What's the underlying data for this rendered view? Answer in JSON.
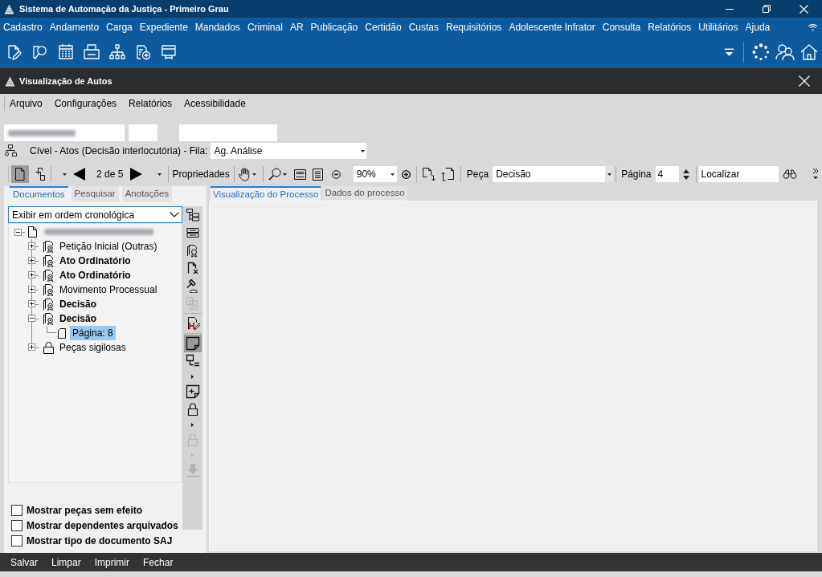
{
  "window": {
    "title": "Sistema de Automação da Justiça - Primeiro Grau"
  },
  "main_menu": [
    "Cadastro",
    "Andamento",
    "Carga",
    "Expediente",
    "Mandados",
    "Criminal",
    "AR",
    "Publicação",
    "Certidão",
    "Custas",
    "Requisitórios",
    "Adolescente Infrator",
    "Consulta",
    "Relatórios",
    "Utilitários",
    "Ajuda"
  ],
  "dialog": {
    "title": "Visualização de Autos"
  },
  "dialog_menu": [
    "Arquivo",
    "Configurações",
    "Relatórios",
    "Acessibilidade"
  ],
  "workflow": {
    "label": "Cível - Atos (Decisão interlocutória) - Fila:",
    "queue": "Ag. Análise"
  },
  "toolbar": {
    "view_modes": [
      {
        "selected": true
      },
      {
        "selected": false
      }
    ],
    "position": "2 de 5",
    "properties": "Propriedades",
    "zoom": "90%",
    "piece_label": "Peça",
    "piece": "Decisão",
    "page_label": "Página",
    "page": "4",
    "search": "Localizar"
  },
  "document_tabs": [
    {
      "label": "Documentos",
      "selected": true
    },
    {
      "label": "Pesquisar",
      "selected": false
    },
    {
      "label": "Anotações",
      "selected": false
    }
  ],
  "order_select": "Exibir em ordem cronológica",
  "tree": [
    {
      "kind": "process",
      "expanded": true,
      "selected": false,
      "children": [
        {
          "kind": "document",
          "label": "Petição Inicial (Outras)",
          "bold": false,
          "expanded": false,
          "selected": false
        },
        {
          "kind": "document",
          "label": "Ato Ordinatório",
          "bold": true,
          "expanded": false,
          "selected": false
        },
        {
          "kind": "document",
          "label": "Ato Ordinatório",
          "bold": true,
          "expanded": false,
          "selected": false
        },
        {
          "kind": "document",
          "label": "Movimento Processual",
          "bold": false,
          "expanded": false,
          "selected": false
        },
        {
          "kind": "document",
          "label": "Decisão",
          "bold": true,
          "expanded": false,
          "selected": false
        },
        {
          "kind": "document",
          "label": "Decisão",
          "bold": true,
          "expanded": true,
          "selected": false,
          "children": [
            {
              "kind": "page",
              "label": "Página: 8",
              "bold": false,
              "selected": true
            }
          ]
        },
        {
          "kind": "lock",
          "label": "Peças sigilosas",
          "bold": false,
          "expanded": false,
          "selected": false
        }
      ]
    }
  ],
  "side_tools": [
    [
      {
        "kind": "tree",
        "selected": false,
        "disabled": false,
        "dropdown": false
      },
      {
        "kind": "list",
        "selected": false,
        "disabled": false,
        "dropdown": false
      },
      {
        "kind": "certificate",
        "selected": false,
        "disabled": false,
        "dropdown": false
      },
      {
        "kind": "remove",
        "selected": false,
        "disabled": false,
        "dropdown": false
      },
      {
        "kind": "gavel",
        "selected": false,
        "disabled": false,
        "dropdown": false
      },
      {
        "kind": "copy",
        "selected": false,
        "disabled": true,
        "dropdown": false
      }
    ],
    [
      {
        "kind": "highlight",
        "selected": false,
        "disabled": false,
        "dropdown": false
      }
    ],
    [
      {
        "kind": "note",
        "selected": true,
        "disabled": false,
        "dropdown": false
      },
      {
        "kind": "node",
        "selected": false,
        "disabled": false,
        "dropdown": true
      },
      {
        "kind": "add-note",
        "selected": false,
        "disabled": false,
        "dropdown": false
      },
      {
        "kind": "lock",
        "selected": false,
        "disabled": false,
        "dropdown": true
      },
      {
        "kind": "lock",
        "selected": false,
        "disabled": true,
        "dropdown": true
      },
      {
        "kind": "download",
        "selected": false,
        "disabled": true,
        "dropdown": false
      }
    ]
  ],
  "options": [
    {
      "label": "Mostrar peças sem efeito",
      "checked": false
    },
    {
      "label": "Mostrar dependentes arquivados",
      "checked": false
    },
    {
      "label": "Mostrar tipo de documento SAJ",
      "checked": false
    }
  ],
  "viewer_tabs": [
    {
      "label": "Visualização do Processo",
      "selected": true
    },
    {
      "label": "Dados do processo",
      "selected": false
    }
  ],
  "footer_buttons": [
    "Salvar",
    "Limpar",
    "Imprimir",
    "Fechar"
  ]
}
